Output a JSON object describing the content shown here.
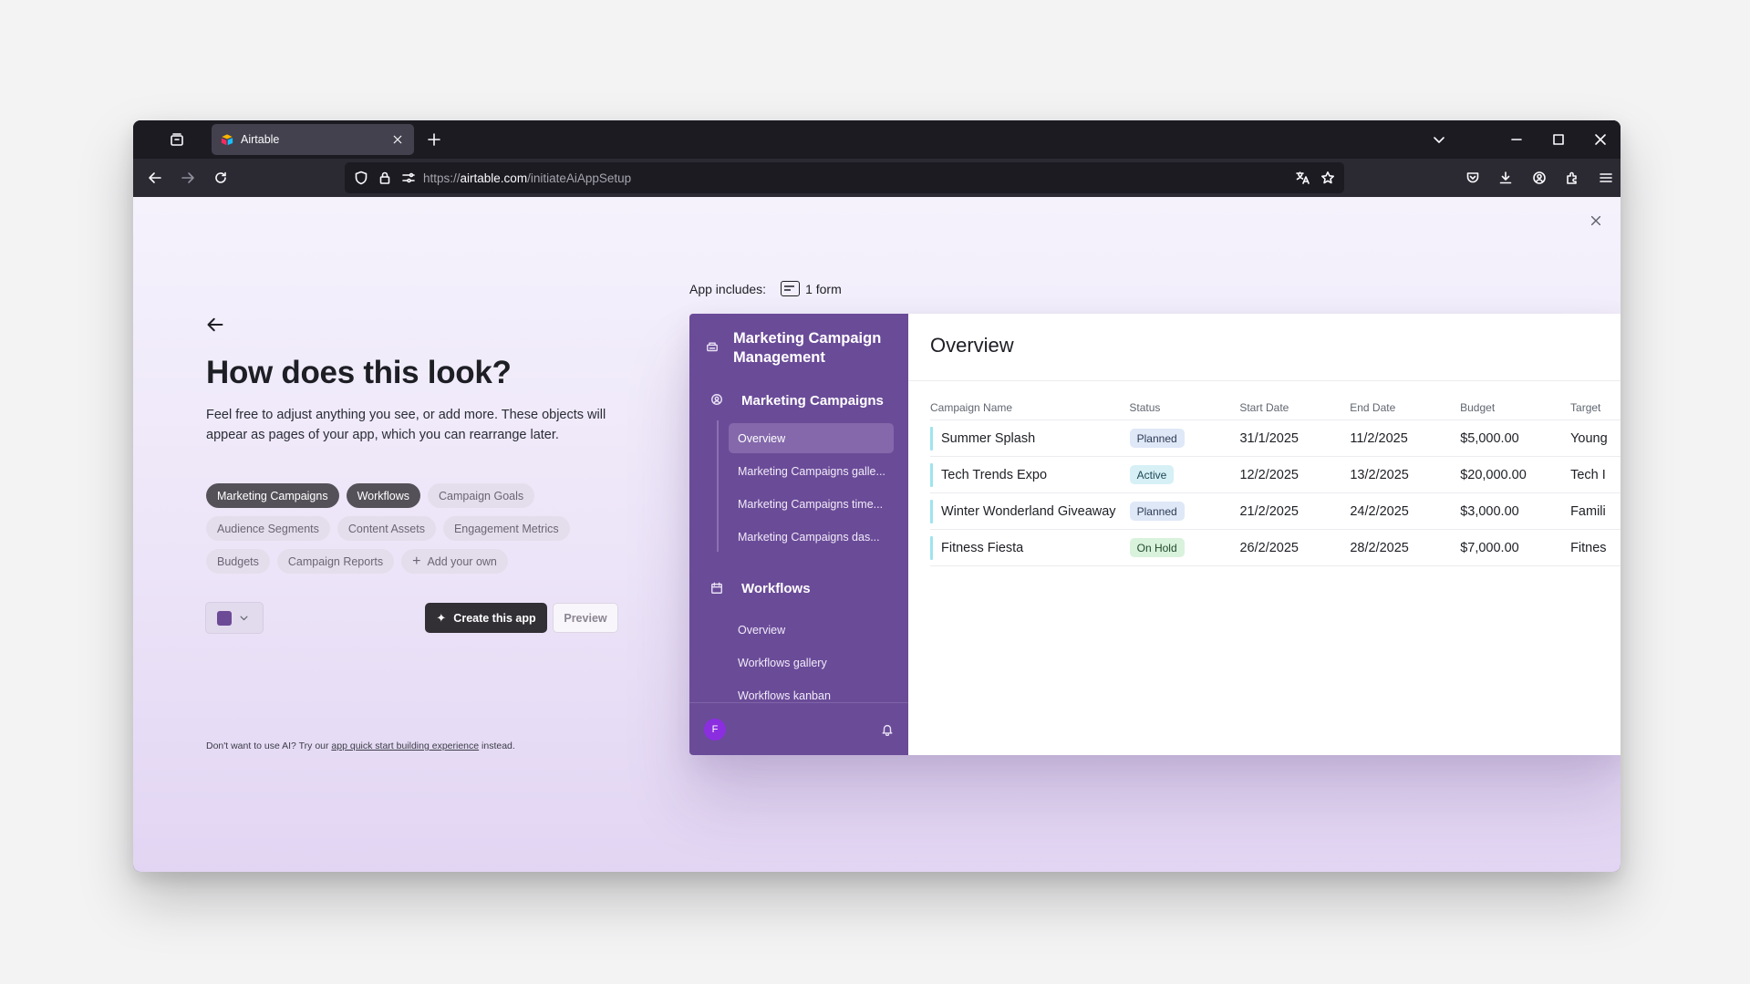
{
  "browser": {
    "tab": {
      "title": "Airtable"
    },
    "url": {
      "protocol": "https://",
      "host": "airtable.com",
      "path": "/initiateAiAppSetup"
    }
  },
  "setup": {
    "heading": "How does this look?",
    "description": "Feel free to adjust anything you see, or add more. These objects will appear as pages of your app, which you can rearrange later.",
    "chips": [
      {
        "label": "Marketing Campaigns",
        "selected": true
      },
      {
        "label": "Workflows",
        "selected": true
      },
      {
        "label": "Campaign Goals",
        "selected": false
      },
      {
        "label": "Audience Segments",
        "selected": false
      },
      {
        "label": "Content Assets",
        "selected": false
      },
      {
        "label": "Engagement Metrics",
        "selected": false
      },
      {
        "label": "Budgets",
        "selected": false
      },
      {
        "label": "Campaign Reports",
        "selected": false
      }
    ],
    "add_own_label": "Add your own",
    "accent_color": "#6d4a96",
    "create_label": "Create this app",
    "preview_label": "Preview",
    "footnote_prefix": "Don't want to use AI? Try our ",
    "footnote_link": "app quick start building experience",
    "footnote_suffix": " instead."
  },
  "includes": {
    "label": "App includes:",
    "value": "1 form"
  },
  "app_preview": {
    "app_name": "Marketing Campaign Management",
    "sidebar_color": "#6a4b98",
    "sections": [
      {
        "title": "Marketing Campaigns",
        "items": [
          "Overview",
          "Marketing Campaigns galle...",
          "Marketing Campaigns time...",
          "Marketing Campaigns das..."
        ]
      },
      {
        "title": "Workflows",
        "items": [
          "Overview",
          "Workflows gallery",
          "Workflows kanban"
        ]
      }
    ],
    "avatar_initial": "F",
    "page_title": "Overview",
    "columns": [
      "Campaign Name",
      "Status",
      "Start Date",
      "End Date",
      "Budget",
      "Target"
    ],
    "rows": [
      {
        "name": "Summer Splash",
        "status": "Planned",
        "start": "31/1/2025",
        "end": "11/2/2025",
        "budget": "$5,000.00",
        "target": "Young"
      },
      {
        "name": "Tech Trends Expo",
        "status": "Active",
        "start": "12/2/2025",
        "end": "13/2/2025",
        "budget": "$20,000.00",
        "target": "Tech I"
      },
      {
        "name": "Winter Wonderland Giveaway",
        "status": "Planned",
        "start": "21/2/2025",
        "end": "24/2/2025",
        "budget": "$3,000.00",
        "target": "Famili"
      },
      {
        "name": "Fitness Fiesta",
        "status": "On Hold",
        "start": "26/2/2025",
        "end": "28/2/2025",
        "budget": "$7,000.00",
        "target": "Fitnes"
      }
    ]
  }
}
